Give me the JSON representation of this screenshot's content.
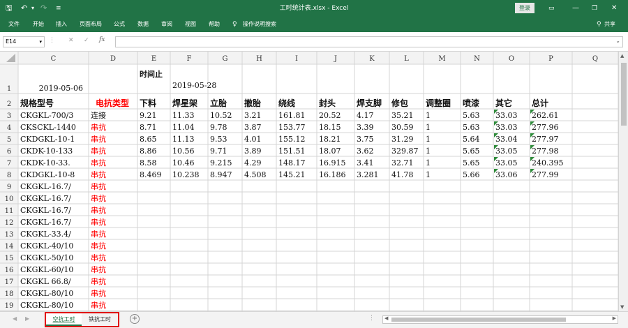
{
  "titlebar": {
    "title": "工时统计表.xlsx  -  Excel",
    "login_label": "登录"
  },
  "ribbon": {
    "tabs": [
      "文件",
      "开始",
      "插入",
      "页面布局",
      "公式",
      "数据",
      "审阅",
      "视图",
      "帮助"
    ],
    "tell_me": "操作说明搜索",
    "share": "共享"
  },
  "formula_bar": {
    "cell_ref": "E14",
    "formula": ""
  },
  "columns": [
    "C",
    "D",
    "E",
    "F",
    "G",
    "H",
    "I",
    "J",
    "K",
    "L",
    "M",
    "N",
    "O",
    "P",
    "Q"
  ],
  "rows": [
    {
      "num": "1",
      "cells": [
        "2019-05-06",
        "",
        "时间止",
        "2019-05-28",
        "",
        "",
        "",
        "",
        "",
        "",
        "",
        "",
        "",
        "",
        ""
      ]
    },
    {
      "num": "2",
      "cells": [
        "规格型号",
        "电抗类型",
        "下料",
        "焊星架",
        "立胎",
        "撤胎",
        "绕线",
        "封头",
        "焊支脚",
        "修包",
        "调整圈",
        "喷漆",
        "其它",
        "总计",
        ""
      ]
    },
    {
      "num": "3",
      "cells": [
        "CKGKL-700/3",
        "连接",
        "9.21",
        "11.33",
        "10.52",
        "3.21",
        "161.81",
        "20.52",
        "4.17",
        "35.21",
        "1",
        "5.63",
        "33.03",
        "262.61",
        ""
      ]
    },
    {
      "num": "4",
      "cells": [
        "CKSCKL-1440",
        "串抗",
        "8.71",
        "11.04",
        "9.78",
        "3.87",
        "153.77",
        "18.15",
        "3.39",
        "30.59",
        "1",
        "5.63",
        "33.03",
        "277.96",
        ""
      ]
    },
    {
      "num": "5",
      "cells": [
        "CKDGKL-10-1",
        "串抗",
        "8.65",
        "11.13",
        "9.53",
        "4.01",
        "155.12",
        "18.21",
        "3.75",
        "31.29",
        "1",
        "5.64",
        "33.04",
        "277.97",
        ""
      ]
    },
    {
      "num": "6",
      "cells": [
        "CKDK-10-133",
        "串抗",
        "8.86",
        "10.56",
        "9.71",
        "3.89",
        "151.51",
        "18.07",
        "3.62",
        "329.87",
        "1",
        "5.65",
        "33.05",
        "277.98",
        ""
      ]
    },
    {
      "num": "7",
      "cells": [
        "CKDK-10-33.",
        "串抗",
        "8.58",
        "10.46",
        "9.215",
        "4.29",
        "148.17",
        "16.915",
        "3.41",
        "32.71",
        "1",
        "5.65",
        "33.05",
        "240.395",
        ""
      ]
    },
    {
      "num": "8",
      "cells": [
        "CKDGKL-10-8",
        "串抗",
        "8.469",
        "10.238",
        "8.947",
        "4.508",
        "145.21",
        "16.186",
        "3.281",
        "41.78",
        "1",
        "5.66",
        "33.06",
        "277.99",
        ""
      ]
    },
    {
      "num": "9",
      "cells": [
        "CKGKL-16.7/",
        "串抗",
        "",
        "",
        "",
        "",
        "",
        "",
        "",
        "",
        "",
        "",
        "",
        "",
        ""
      ]
    },
    {
      "num": "10",
      "cells": [
        "CKGKL-16.7/",
        "串抗",
        "",
        "",
        "",
        "",
        "",
        "",
        "",
        "",
        "",
        "",
        "",
        "",
        ""
      ]
    },
    {
      "num": "11",
      "cells": [
        "CKGKL-16.7/",
        "串抗",
        "",
        "",
        "",
        "",
        "",
        "",
        "",
        "",
        "",
        "",
        "",
        "",
        ""
      ]
    },
    {
      "num": "12",
      "cells": [
        "CKGKL-16.7/",
        "串抗",
        "",
        "",
        "",
        "",
        "",
        "",
        "",
        "",
        "",
        "",
        "",
        "",
        ""
      ]
    },
    {
      "num": "13",
      "cells": [
        "CKGKL-33.4/",
        "串抗",
        "",
        "",
        "",
        "",
        "",
        "",
        "",
        "",
        "",
        "",
        "",
        "",
        ""
      ]
    },
    {
      "num": "14",
      "cells": [
        "CKGKL-40/10",
        "串抗",
        "",
        "",
        "",
        "",
        "",
        "",
        "",
        "",
        "",
        "",
        "",
        "",
        ""
      ]
    },
    {
      "num": "15",
      "cells": [
        "CKGKL-50/10",
        "串抗",
        "",
        "",
        "",
        "",
        "",
        "",
        "",
        "",
        "",
        "",
        "",
        "",
        ""
      ]
    },
    {
      "num": "16",
      "cells": [
        "CKGKL-60/10",
        "串抗",
        "",
        "",
        "",
        "",
        "",
        "",
        "",
        "",
        "",
        "",
        "",
        "",
        ""
      ]
    },
    {
      "num": "17",
      "cells": [
        "CKGKL 66.8/",
        "串抗",
        "",
        "",
        "",
        "",
        "",
        "",
        "",
        "",
        "",
        "",
        "",
        "",
        ""
      ]
    },
    {
      "num": "18",
      "cells": [
        "CKGKL-80/10",
        "串抗",
        "",
        "",
        "",
        "",
        "",
        "",
        "",
        "",
        "",
        "",
        "",
        "",
        ""
      ]
    },
    {
      "num": "19",
      "cells": [
        "CKGKL-80/10",
        "串抗",
        "",
        "",
        "",
        "",
        "",
        "",
        "",
        "",
        "",
        "",
        "",
        "",
        ""
      ]
    }
  ],
  "sheet_tabs": [
    {
      "label": "空抗工时",
      "active": true
    },
    {
      "label": "铁抗工时",
      "active": false
    }
  ],
  "colors": {
    "accent": "#217346",
    "red_text": "#ff0000",
    "active_tab_text": "#217346",
    "highlight_box": "#e00000"
  }
}
